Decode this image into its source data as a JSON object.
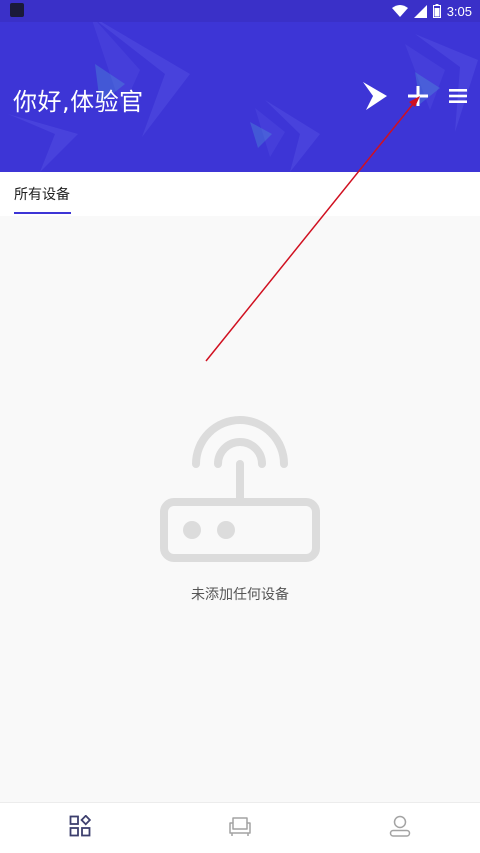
{
  "status_bar": {
    "time": "3:05",
    "icons": [
      "app-notification-icon",
      "wifi-icon",
      "signal-icon",
      "battery-icon"
    ]
  },
  "header": {
    "greeting": "你好,体验官",
    "actions": [
      "fish-logo-icon",
      "add-icon",
      "menu-icon"
    ],
    "colors": {
      "background": "#3d35d6",
      "foreground": "#ffffff"
    }
  },
  "tabs": [
    {
      "label": "所有设备",
      "active": true
    }
  ],
  "empty_state": {
    "icon": "router-icon",
    "message": "未添加任何设备"
  },
  "annotation": {
    "type": "red-arrow",
    "color": "#d01020",
    "points_to": "add-icon"
  },
  "bottom_nav": {
    "items": [
      {
        "icon": "devices-grid-icon",
        "active": true
      },
      {
        "icon": "sofa-icon",
        "active": false
      },
      {
        "icon": "profile-icon",
        "active": false
      }
    ]
  },
  "colors": {
    "accent": "#3d35d6",
    "page_background": "#f9f9f9"
  }
}
